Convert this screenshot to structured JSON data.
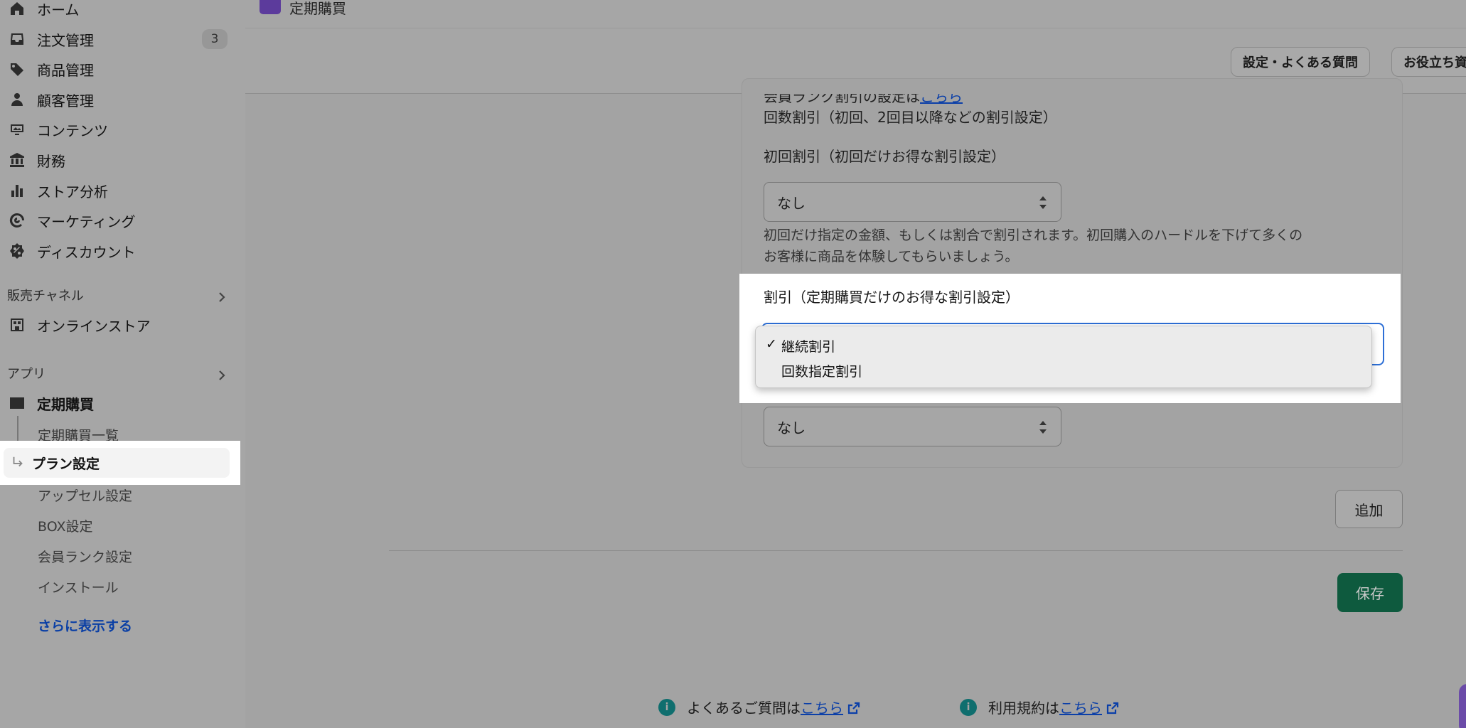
{
  "sidebar": {
    "items": [
      {
        "label": "ホーム",
        "icon": "home-icon"
      },
      {
        "label": "注文管理",
        "icon": "inbox-icon",
        "badge": "3"
      },
      {
        "label": "商品管理",
        "icon": "tag-icon"
      },
      {
        "label": "顧客管理",
        "icon": "person-icon"
      },
      {
        "label": "コンテンツ",
        "icon": "image-icon"
      },
      {
        "label": "財務",
        "icon": "bank-icon"
      },
      {
        "label": "ストア分析",
        "icon": "bar-chart-icon"
      },
      {
        "label": "マーケティング",
        "icon": "target-icon"
      },
      {
        "label": "ディスカウント",
        "icon": "discount-icon"
      }
    ],
    "sales_channels": {
      "title": "販売チャネル",
      "online_store": "オンラインストア"
    },
    "apps": {
      "title": "アプリ",
      "app_name": "定期購買",
      "sub_items": [
        "定期購買一覧",
        "プラン設定",
        "アップセル設定",
        "BOX設定",
        "会員ランク設定",
        "インストール"
      ],
      "show_more": "さらに表示する"
    }
  },
  "header": {
    "app_title": "定期購買",
    "buttons": [
      "設定・よくある質問",
      "お役立ち資"
    ]
  },
  "card": {
    "cut_line_text": "会員ランク割引の設定は",
    "cut_line_link": "こちら",
    "count_discount_label": "回数割引（初回、2回目以降などの割引設定）",
    "first_discount_label": "初回割引（初回だけお得な割引設定）",
    "first_discount_value": "なし",
    "first_discount_help_1": "初回だけ指定の金額、もしくは割合で割引されます。初回購入のハードルを下げて多くの",
    "first_discount_help_2": "お客様に商品を体験してもらいましょう。",
    "subscription_discount_label": "割引（定期購買だけのお得な割引設定）",
    "dropdown_options": [
      {
        "label": "継続割引",
        "selected": true
      },
      {
        "label": "回数指定割引",
        "selected": false
      }
    ],
    "second_select_value": "なし"
  },
  "actions": {
    "add": "追加",
    "save": "保存"
  },
  "footer": {
    "faq_text": "よくあるご質問は",
    "faq_link": "こちら",
    "terms_text": "利用規約は",
    "terms_link": "こちら"
  },
  "colors": {
    "accent": "#2d6fd6",
    "save": "#0e5a3e",
    "link": "#0b3fa8",
    "info": "#0f6e6e"
  }
}
